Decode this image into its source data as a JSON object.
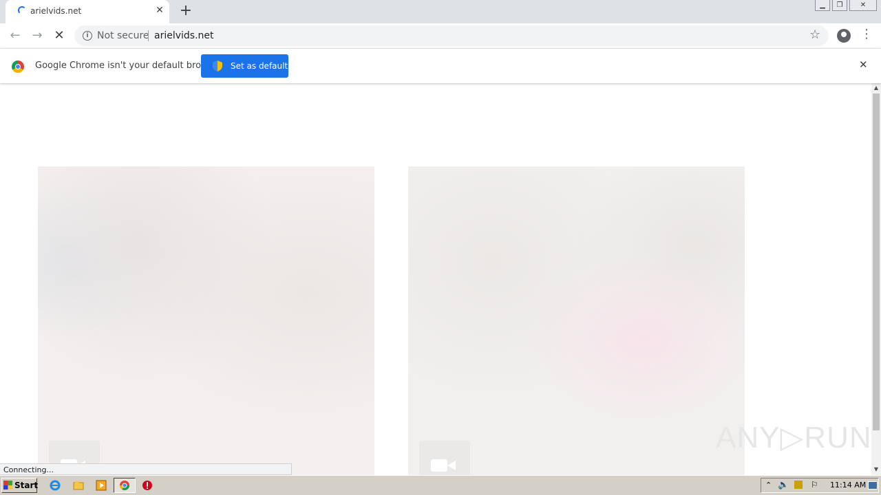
{
  "browser": {
    "tab": {
      "title": "arielvids.net"
    },
    "window_controls": {
      "minimize": "▁",
      "restore": "❐",
      "close": "✕"
    },
    "omnibox": {
      "security_label": "Not secure",
      "url": "arielvids.net"
    },
    "infobar": {
      "message": "Google Chrome isn't your default browser",
      "button_label": "Set as default"
    },
    "status_text": "Connecting..."
  },
  "page": {
    "watermark": "ANY▷RUN",
    "thumbnails": [
      {
        "icon": "video-camera-icon"
      },
      {
        "icon": "video-camera-icon"
      }
    ]
  },
  "taskbar": {
    "start_label": "Start",
    "clock": "11:14 AM",
    "pinned": [
      "internet-explorer-icon",
      "file-explorer-icon",
      "media-player-icon",
      "chrome-icon",
      "security-warning-icon"
    ]
  },
  "colors": {
    "accent": "#1a73e8",
    "tabstrip": "#dee1e6",
    "taskbar": "#d4d0c8"
  }
}
